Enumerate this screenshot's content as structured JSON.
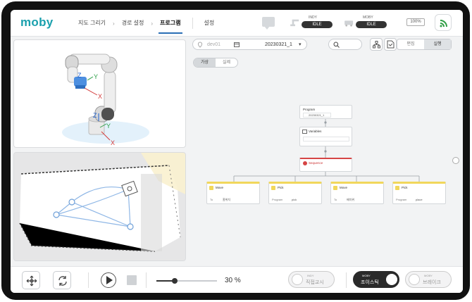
{
  "app": {
    "logo": "moby"
  },
  "nav": {
    "items": [
      {
        "label": "지도 그리기",
        "active": false
      },
      {
        "label": "경로 설정",
        "active": false
      },
      {
        "label": "프로그램",
        "active": true
      },
      {
        "label": "설정",
        "active": false
      }
    ],
    "separator": "›"
  },
  "status": {
    "indy": {
      "name": "INDY",
      "state": "IDLE"
    },
    "moby": {
      "name": "MOBY",
      "state": "IDLE"
    },
    "battery": "100%",
    "wifi_icon": "wifi-icon"
  },
  "robot_view": {
    "axes": [
      {
        "label": "Z",
        "color": "#1a5fd0"
      },
      {
        "label": "Y",
        "color": "#2fa04a"
      },
      {
        "label": "X",
        "color": "#d33b3b"
      }
    ]
  },
  "program": {
    "location": "dev01",
    "program_id": "20230321_1",
    "mode_toggle": [
      {
        "label": "편집",
        "active": false
      },
      {
        "label": "실행",
        "active": true
      }
    ],
    "sub_toggle": [
      {
        "label": "가상",
        "active": true
      },
      {
        "label": "실제",
        "active": false
      }
    ],
    "nodes": {
      "program": {
        "title": "Program",
        "value": "20230321_1"
      },
      "variables": {
        "title": "Variables"
      },
      "sequence": {
        "title": "Sequence"
      },
      "branches": [
        {
          "title": "Move",
          "label": "To",
          "value": "홈위치"
        },
        {
          "title": "Pick",
          "label": "Program",
          "value": "pick"
        },
        {
          "title": "Move",
          "label": "To",
          "value": "배치위"
        },
        {
          "title": "Pick",
          "label": "Program",
          "value": "place"
        }
      ]
    }
  },
  "controls": {
    "speed_percent": 30,
    "speed_text": "30 %",
    "modes": [
      {
        "tiny": "INDY",
        "label": "직접교시",
        "active": false
      },
      {
        "tiny": "MOBY",
        "label": "조이스틱",
        "active": true
      },
      {
        "tiny": "MOBY",
        "label": "브레이크",
        "active": false
      }
    ]
  }
}
